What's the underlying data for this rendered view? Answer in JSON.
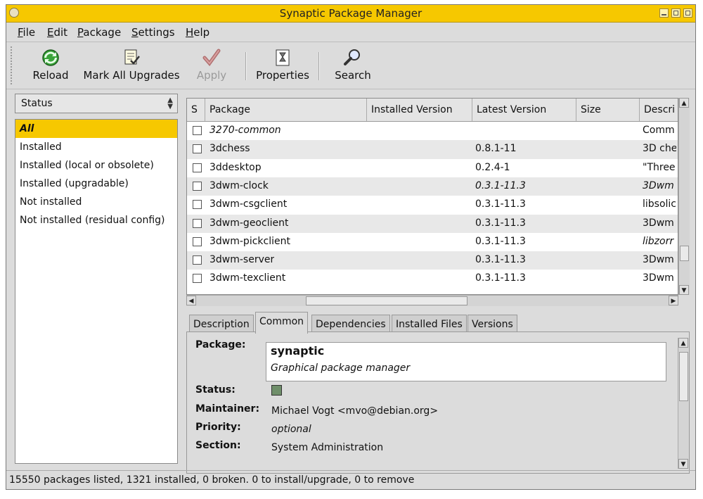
{
  "window": {
    "title": "Synaptic Package Manager"
  },
  "menu": [
    {
      "accel": "F",
      "rest": "ile"
    },
    {
      "accel": "E",
      "rest": "dit"
    },
    {
      "accel": "P",
      "rest": "ackage"
    },
    {
      "accel": "S",
      "rest": "ettings"
    },
    {
      "accel": "H",
      "rest": "elp"
    }
  ],
  "toolbar": {
    "reload": "Reload",
    "mark_all": "Mark All Upgrades",
    "apply": "Apply",
    "properties": "Properties",
    "search": "Search"
  },
  "filter": {
    "selected": "Status",
    "items": [
      "All",
      "Installed",
      "Installed (local or obsolete)",
      "Installed (upgradable)",
      "Not installed",
      "Not installed (residual config)"
    ]
  },
  "table": {
    "columns": [
      "S",
      "Package",
      "Installed Version",
      "Latest Version",
      "Size",
      "Descri"
    ],
    "rows": [
      {
        "name": "3270-common",
        "latest": "",
        "desc": "Comm"
      },
      {
        "name": "3dchess",
        "latest": "0.8.1-11",
        "desc": "3D che"
      },
      {
        "name": "3ddesktop",
        "latest": "0.2.4-1",
        "desc": "\"Three"
      },
      {
        "name": "3dwm-clock",
        "latest": "0.3.1-11.3",
        "desc": "3Dwm"
      },
      {
        "name": "3dwm-csgclient",
        "latest": "0.3.1-11.3",
        "desc": "libsolic"
      },
      {
        "name": "3dwm-geoclient",
        "latest": "0.3.1-11.3",
        "desc": "3Dwm"
      },
      {
        "name": "3dwm-pickclient",
        "latest": "0.3.1-11.3",
        "desc": "libzorr"
      },
      {
        "name": "3dwm-server",
        "latest": "0.3.1-11.3",
        "desc": "3Dwm"
      },
      {
        "name": "3dwm-texclient",
        "latest": "0.3.1-11.3",
        "desc": "3Dwm"
      }
    ]
  },
  "tabs": [
    "Description",
    "Common",
    "Dependencies",
    "Installed Files",
    "Versions"
  ],
  "details": {
    "package_label": "Package:",
    "package_name": "synaptic",
    "package_summary": "Graphical package manager",
    "status_label": "Status:",
    "status_color": "#6f8f6a",
    "maintainer_label": "Maintainer:",
    "maintainer": "Michael Vogt <mvo@debian.org>",
    "priority_label": "Priority:",
    "priority": "optional",
    "section_label": "Section:",
    "section": "System Administration"
  },
  "statusbar": "15550 packages listed, 1321 installed, 0 broken. 0 to install/upgrade, 0 to remove"
}
